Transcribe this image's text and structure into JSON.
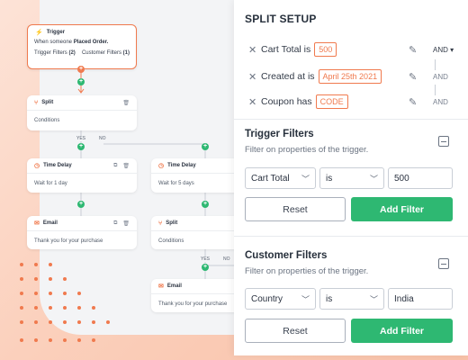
{
  "colors": {
    "accent": "#f07a4e",
    "green": "#2eb872",
    "panel_bg": "#ffffff"
  },
  "canvas": {
    "trigger_node": {
      "title": "Trigger",
      "icon": "bolt-icon",
      "desc_prefix": "When someone",
      "desc_event": "Placed Order.",
      "trigger_filters": "Trigger Filters",
      "trigger_filters_count": "(2)",
      "customer_filters": "Customer Filters",
      "customer_filters_count": "(1)"
    },
    "split_node_1": {
      "title": "Split",
      "body": "Conditions"
    },
    "branch_labels": {
      "yes": "YES",
      "no": "NO"
    },
    "time_delay_1": {
      "title": "Time Delay",
      "body": "Wait for 1 day"
    },
    "time_delay_2": {
      "title": "Time Delay",
      "body": "Wait for 5 days"
    },
    "email_1": {
      "title": "Email",
      "body": "Thank you for your purchase"
    },
    "split_node_2": {
      "title": "Split",
      "body": "Conditions"
    },
    "email_2": {
      "title": "Email",
      "body": "Thank you for your purchase"
    }
  },
  "panel": {
    "title": "SPLIT SETUP",
    "conditions": [
      {
        "label": "Cart Total is",
        "value": "500",
        "operator": "AND ▾"
      },
      {
        "label": "Created at is",
        "value": "April 25th 2021",
        "operator": "AND"
      },
      {
        "label": "Coupon has",
        "value": "CODE",
        "operator": "AND"
      }
    ],
    "trigger_filters": {
      "title": "Trigger Filters",
      "subtitle": "Filter on properties of the trigger.",
      "field": "Cart Total",
      "operator": "is",
      "value": "500",
      "reset_label": "Reset",
      "add_label": "Add Filter"
    },
    "customer_filters": {
      "title": "Customer Filters",
      "subtitle": "Filter on properties of the trigger.",
      "field": "Country",
      "operator": "is",
      "value": "India",
      "reset_label": "Reset",
      "add_label": "Add Filter"
    }
  }
}
